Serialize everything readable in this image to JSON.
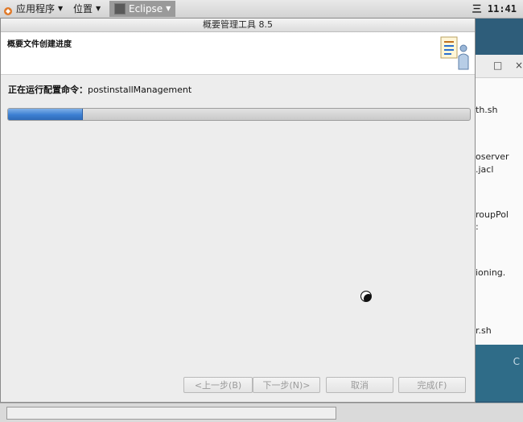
{
  "topbar": {
    "apps_label": "应用程序",
    "places_label": "位置",
    "eclipse_label": "Eclipse",
    "clock": "三 11:41"
  },
  "dialog": {
    "title": "概要管理工具 8.5",
    "banner_title": "概要文件创建进度",
    "status_label": "正在运行配置命令：",
    "status_command": "postinstallManagement",
    "progress": 0.16,
    "buttons": {
      "back": "<上一步(B)",
      "next": "下一步(N)>",
      "cancel": "取消",
      "finish": "完成(F)"
    }
  },
  "background_window": {
    "restore_glyph": "□",
    "close_glyph": "×",
    "lines": [
      "th.sh",
      "oserver",
      ".jacl",
      "roupPol",
      ":",
      "ioning.",
      "r.sh"
    ],
    "lower_glyph": "C"
  },
  "colors": {
    "progress_fill": "#3c7fd2",
    "desktop": "#2e5d7a"
  }
}
